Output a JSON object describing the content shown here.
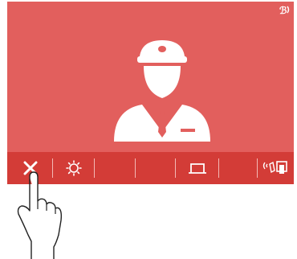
{
  "screen": {
    "background_color": "#e25f5d",
    "toolbar_color": "#d33c37"
  },
  "icons": {
    "corner": "speaker-volume-icon",
    "main": "visitor-avatar-icon",
    "toolbar": [
      "close-icon",
      "brightness-icon",
      "blank",
      "blank",
      "door-release-icon",
      "blank",
      "transfer-call-icon"
    ]
  },
  "overlay": {
    "pointer": "tapping-hand-icon"
  }
}
